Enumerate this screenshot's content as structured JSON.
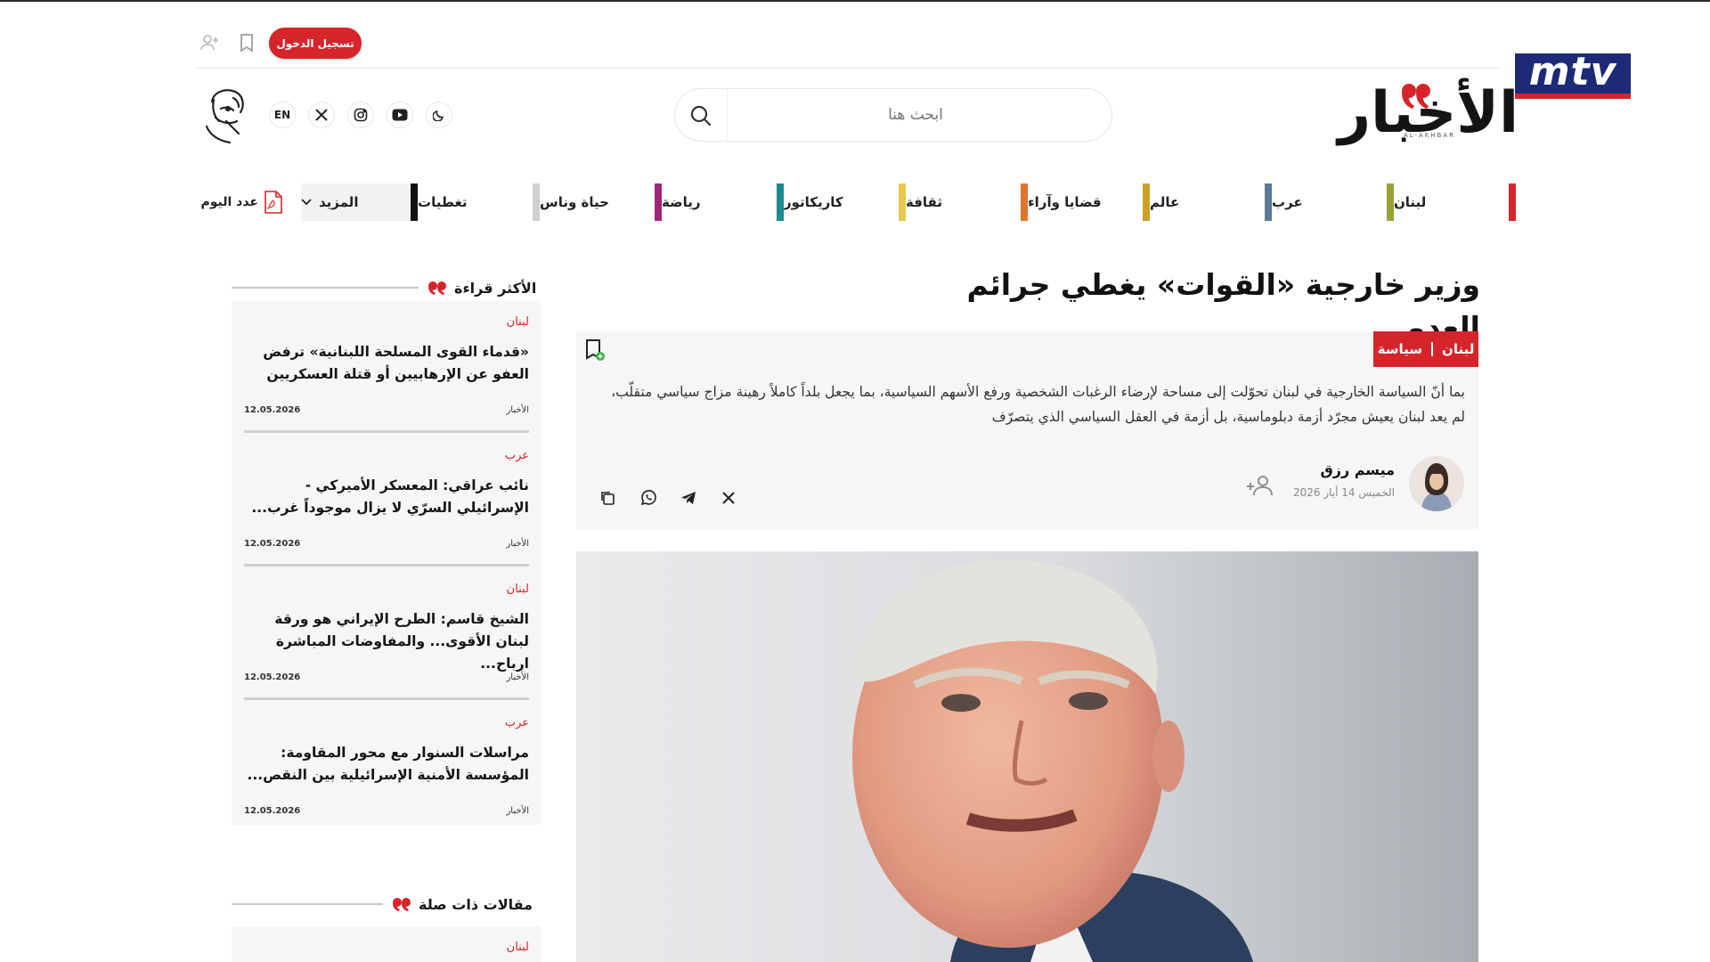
{
  "header": {
    "login_label": "تسجيل الدخول",
    "search_placeholder": "ابحث هنا",
    "lang_label": "EN",
    "logo_text": "الأخبار",
    "logo_sub": "AL-AKHBAR",
    "mtv_label": "mtv"
  },
  "nav": {
    "items": [
      {
        "label": "لبنان",
        "color": "#d6242b"
      },
      {
        "label": "عرب",
        "color": "#9aa23a"
      },
      {
        "label": "عالم",
        "color": "#5d7a95"
      },
      {
        "label": "قضايا وآراء",
        "color": "#c9a227"
      },
      {
        "label": "ثقافة",
        "color": "#e0752e"
      },
      {
        "label": "كاريكاتور",
        "color": "#e7c94b"
      },
      {
        "label": "رياضة",
        "color": "#1f8a8a"
      },
      {
        "label": "حياة وناس",
        "color": "#a0267a"
      },
      {
        "label": "تغطيات",
        "color": "#cfcfcf"
      }
    ],
    "more_label": "المزيد",
    "more_color": "#111111",
    "today_label": "عدد اليوم"
  },
  "article": {
    "headline": "وزير خارجية «القوات» يغطي جرائم العدو",
    "category_primary": "لبنان",
    "category_secondary": "سياسة",
    "summary": "بما أنّ السياسة الخارجية في لبنان تحوّلت إلى مساحة لإرضاء الرغبات الشخصية ورفع الأسهم السياسية، بما يجعل بلداً كاملاً رهينة مزاج سياسي متقلّب، لم يعد لبنان يعيش مجرّد أزمة دبلوماسية، بل أزمة في العقل السياسي الذي يتصرّف",
    "author_name": "ميسم رزق",
    "author_date": "الخميس 14 أيار 2026"
  },
  "sidebar": {
    "most_read_title": "الأكثر قراءة",
    "related_title": "مقالات ذات صلة",
    "related_first_category": "لبنان",
    "items": [
      {
        "category": "لبنان",
        "headline": "«قدماء القوى المسلحة اللبنانية» ترفض العفو عن الإرهابيين أو قتلة العسكريين",
        "source": "الأخبار",
        "date": "12.05.2026"
      },
      {
        "category": "عرب",
        "headline": "نائب عراقي: المعسكر الأميركي - الإسرائيلي السرّي لا يزال موجوداً غرب...",
        "source": "الأخبار",
        "date": "12.05.2026"
      },
      {
        "category": "لبنان",
        "headline": "الشيخ قاسم: الطرح الإيراني هو ورقة لبنان الأقوى... والمفاوضات المباشرة ارباح...",
        "source": "الأخبار",
        "date": "12.05.2026"
      },
      {
        "category": "عرب",
        "headline": "مراسلات السنوار مع محور المقاومة: المؤسسة الأمنية الإسرائيلية بين النقص...",
        "source": "الأخبار",
        "date": "12.05.2026"
      }
    ]
  },
  "colors": {
    "accent": "#d6242b",
    "mtv_blue": "#1d2a78",
    "panel": "#f6f6f6"
  },
  "icons": [
    "add-user-icon",
    "bookmark-icon",
    "search-icon",
    "x-icon",
    "instagram-icon",
    "youtube-icon",
    "moon-icon",
    "pdf-icon",
    "bookmark-add-icon",
    "follow-author-icon",
    "copy-icon",
    "whatsapp-icon",
    "telegram-icon",
    "x-share-icon",
    "quote-icon"
  ]
}
